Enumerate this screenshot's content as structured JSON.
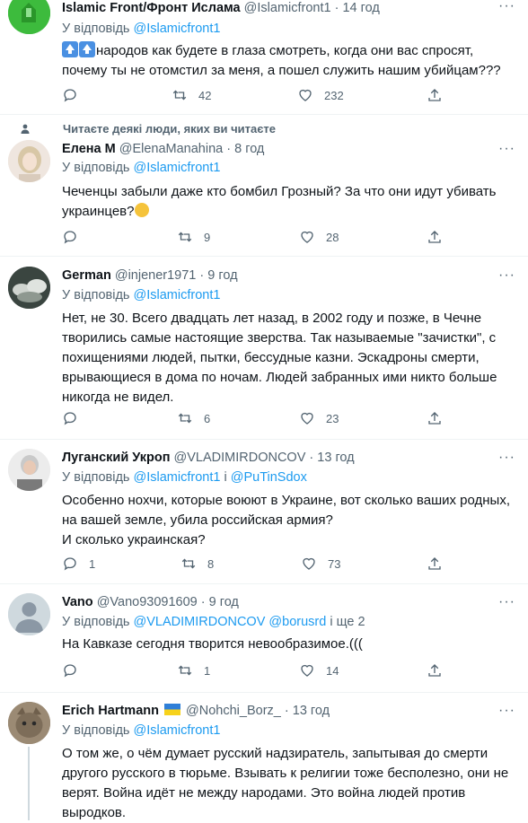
{
  "tweets": [
    {
      "name": "Islamic Front/Фронт Ислама",
      "handle": "@Islamicfront1",
      "time": "14 год",
      "reply_prefix": "У відповідь",
      "reply_to": "@Islamicfront1",
      "text_line1": "народов как будете в глаза смотреть, когда они вас спросят,",
      "text_line2": "почему ты не отомстил за меня, а пошел служить нашим убийцам???",
      "badge_icons": [
        "keycap-up-icon",
        "keycap-up-icon"
      ],
      "replies": "",
      "retweets": "42",
      "likes": "232"
    },
    {
      "social_context": "Читаєте деякі люди, яких ви читаєте",
      "name": "Елена М",
      "handle": "@ElenaManahina",
      "time": "8 год",
      "reply_prefix": "У відповідь",
      "reply_to": "@Islamicfront1",
      "text_line1": "Чеченцы забыли даже кто бомбил Грозный? За что они идут убивать",
      "text_line2": "украинцев?",
      "replies": "",
      "retweets": "9",
      "likes": "28"
    },
    {
      "name": "German",
      "handle": "@injener1971",
      "time": "9 год",
      "reply_prefix": "У відповідь",
      "reply_to": "@Islamicfront1",
      "lines": [
        "Нет, не 30. Всего двадцать лет назад, в 2002 году и позже, в Чечне",
        "творились самые настоящие зверства. Так называемые \"зачистки\", с",
        "похищениями людей, пытки, бессудные казни. Эскадроны смерти,",
        "врывающиеся в дома по ночам. Людей забранных ими никто больше",
        "никогда не видел."
      ],
      "replies": "",
      "retweets": "6",
      "likes": "23"
    },
    {
      "name": "Луганский Укроп",
      "handle": "@VLADIMIRDONCOV",
      "time": "13 год",
      "reply_prefix": "У відповідь",
      "reply_to": "@Islamicfront1",
      "reply_and": "і",
      "reply_to2": "@PuTinSdox",
      "lines": [
        "Особенно нохчи, которые воюют в Украине, вот сколько ваших родных,",
        "на вашей земле, убила российская армия?",
        "И сколько украинская?"
      ],
      "replies": "1",
      "retweets": "8",
      "likes": "73"
    },
    {
      "name": "Vano",
      "handle": "@Vano93091609",
      "time": "9 год",
      "reply_prefix": "У відповідь",
      "reply_to": "@VLADIMIRDONCOV",
      "reply_to2": "@borusrd",
      "reply_rest": "і ще 2",
      "lines": [
        "На Кавказе сегодня творится невообразимое.((("
      ],
      "replies": "",
      "retweets": "1",
      "likes": "14"
    },
    {
      "name": "Erich Hartmann",
      "handle": "@Nohchi_Borz_",
      "time": "13 год",
      "reply_prefix": "У відповідь",
      "reply_to": "@Islamicfront1",
      "lines": [
        "О том же, о чём думает русский надзиратель, запытывая до смерти",
        "другого русского в тюрьме. Взывать к религии тоже бесполезно, они не",
        "верят. Война идёт не между народами. Это война людей против",
        "выродков."
      ]
    }
  ],
  "colors": {
    "link": "#1d9bf0",
    "muted": "#536471",
    "text": "#0f1419",
    "divider": "#eff3f4"
  }
}
